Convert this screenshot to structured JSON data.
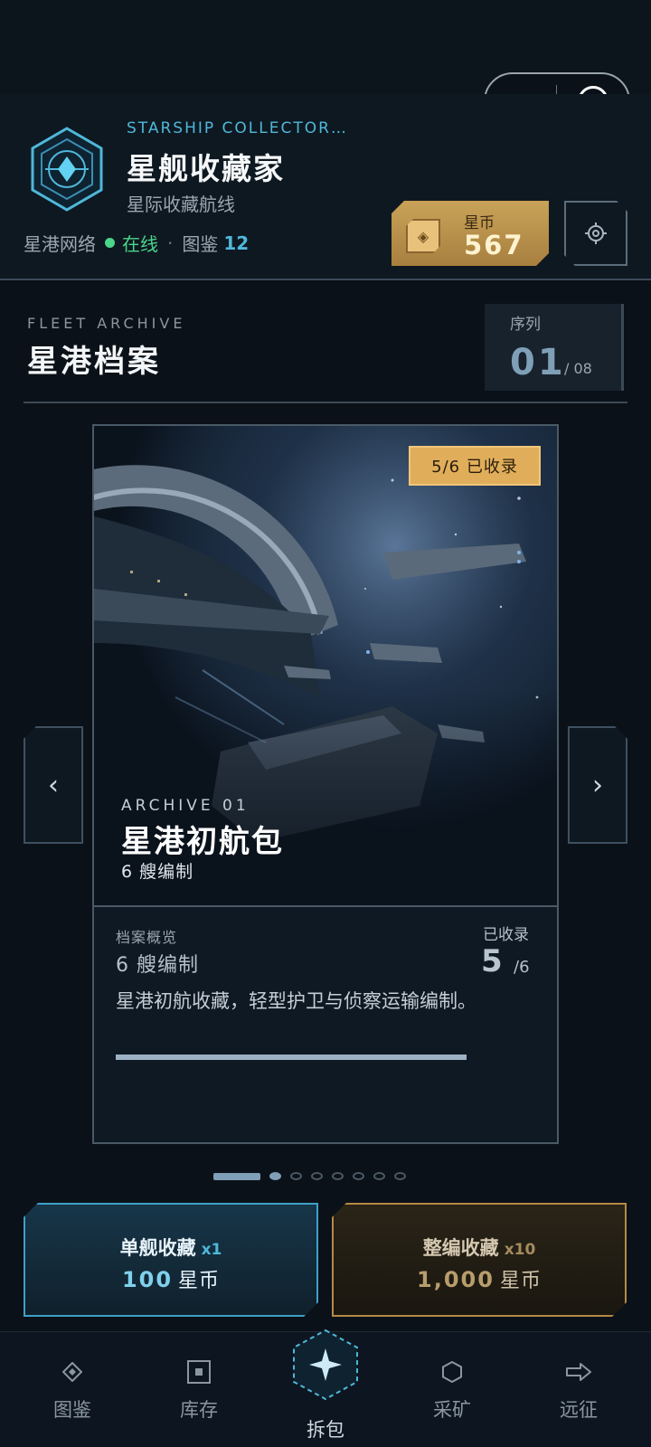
{
  "header": {
    "subtitle_en": "STARSHIP COLLECTOR…",
    "title": "星舰收藏家",
    "subtitle": "星际收藏航线",
    "network_label": "星港网络",
    "online_label": "在线",
    "separator": "·",
    "catalog_label": "图鉴",
    "catalog_count": "12"
  },
  "coins": {
    "label": "星币",
    "value": "567"
  },
  "archive": {
    "label_en": "FLEET ARCHIVE",
    "title": "星港档案",
    "sequence_label": "序列",
    "sequence_current": "01",
    "sequence_total": "/ 08"
  },
  "card": {
    "badge": "5/6 已收录",
    "archive_en": "ARCHIVE 01",
    "name": "星港初航包",
    "ships": "6 艘编制",
    "overview_label": "档案概览",
    "overview_ships": "6 艘编制",
    "collected_label": "已收录",
    "collected_value": "5",
    "collected_total": "/6",
    "description": "星港初航收藏，轻型护卫与侦察运输编制。",
    "progress": 0.833
  },
  "carousel": {
    "prev_icon": "‹",
    "next_icon": "›",
    "page_count": 8,
    "active_index": 0
  },
  "purchase": {
    "single": {
      "name": "单舰收藏",
      "mult": "x1",
      "price": "100",
      "unit": "星币"
    },
    "team": {
      "name": "整编收藏",
      "mult": "x10",
      "price": "1,000",
      "unit": "星币"
    }
  },
  "tabs": [
    {
      "label": "图鉴",
      "icon": "catalog-icon"
    },
    {
      "label": "库存",
      "icon": "inventory-icon"
    },
    {
      "label": "拆包",
      "icon": "unpack-icon"
    },
    {
      "label": "采矿",
      "icon": "mining-icon"
    },
    {
      "label": "远征",
      "icon": "expedition-icon"
    }
  ],
  "colors": {
    "accent_blue": "#4fb8d9",
    "gold": "#c8a258",
    "online_green": "#4ad58a",
    "background": "#0b1118"
  }
}
